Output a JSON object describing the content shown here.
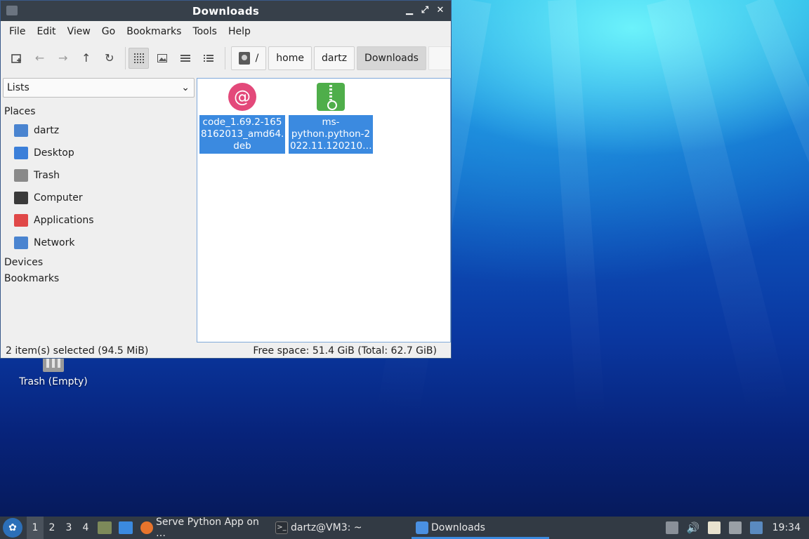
{
  "window": {
    "title": "Downloads"
  },
  "menubar": [
    "File",
    "Edit",
    "View",
    "Go",
    "Bookmarks",
    "Tools",
    "Help"
  ],
  "toolbar": {
    "breadcrumbs": [
      "/",
      "home",
      "dartz",
      "Downloads"
    ],
    "active_crumb": "Downloads"
  },
  "sidebar": {
    "selector_value": "Lists",
    "places_header": "Places",
    "places": [
      {
        "label": "dartz",
        "icon": "home-folder-icon",
        "color": "#4a84d0"
      },
      {
        "label": "Desktop",
        "icon": "desktop-icon",
        "color": "#3b7fd9"
      },
      {
        "label": "Trash",
        "icon": "trash-icon",
        "color": "#8a8a8a"
      },
      {
        "label": "Computer",
        "icon": "computer-icon",
        "color": "#3a3a3a"
      },
      {
        "label": "Applications",
        "icon": "applications-icon",
        "color": "#e04848"
      },
      {
        "label": "Network",
        "icon": "network-folder-icon",
        "color": "#4a84d0"
      }
    ],
    "devices_header": "Devices",
    "bookmarks_header": "Bookmarks"
  },
  "files": [
    {
      "name_lines": [
        "code_1.69.2-165",
        "8162013_amd64.",
        "deb"
      ],
      "icon": "debian-package-icon"
    },
    {
      "name_lines": [
        "ms-",
        "python.python-2",
        "022.11.120210…"
      ],
      "icon": "zip-archive-icon"
    }
  ],
  "status": {
    "selection": "2 item(s) selected (94.5 MiB)",
    "free_space": "Free space: 51.4 GiB (Total: 62.7 GiB)"
  },
  "desktop": {
    "trash_label": "Trash (Empty)"
  },
  "taskbar": {
    "workspaces": [
      "1",
      "2",
      "3",
      "4"
    ],
    "current_workspace": "1",
    "tasks": [
      {
        "label": "Serve Python App on …",
        "icon": "firefox-icon",
        "color": "#e8742c"
      },
      {
        "label": "dartz@VM3: ~",
        "icon": "terminal-icon",
        "color": "#2a2f36"
      },
      {
        "label": "Downloads",
        "icon": "folder-icon",
        "color": "#4a90e2"
      }
    ],
    "clock": "19:34"
  },
  "colors": {
    "selection": "#3b8ae0",
    "titlebar": "#37404a",
    "taskbar": "#323a44"
  }
}
